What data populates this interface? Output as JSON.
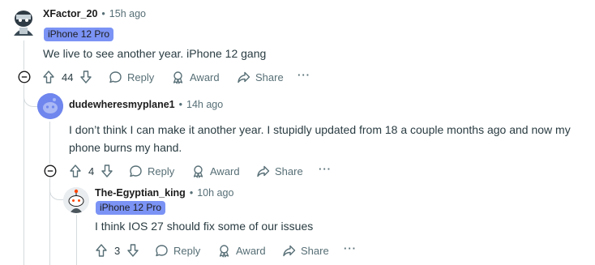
{
  "comments": [
    {
      "author": "XFactor_20",
      "time": "15h ago",
      "flair": "iPhone 12 Pro",
      "body": "We live to see another year. iPhone 12 gang",
      "votes": "44",
      "actions": {
        "reply": "Reply",
        "award": "Award",
        "share": "Share",
        "more": "···"
      }
    },
    {
      "author": "dudewheresmyplane1",
      "time": "14h ago",
      "body_line1": "I don’t think I can make it another year. I stupidly updated from 18 a couple months ago and now my",
      "body_line2": "phone burns my hand.",
      "votes": "4",
      "actions": {
        "reply": "Reply",
        "award": "Award",
        "share": "Share",
        "more": "···"
      }
    },
    {
      "author": "The-Egyptian_king",
      "time": "10h ago",
      "flair": "iPhone 12 Pro",
      "body": "I think IOS 27 should fix some of our issues",
      "votes": "3",
      "actions": {
        "reply": "Reply",
        "award": "Award",
        "share": "Share",
        "more": "···"
      }
    }
  ],
  "separator": "•",
  "colors": {
    "flair_bg": "#7b93f5",
    "meta": "#576f76",
    "thread_line": "#d4dadd",
    "avatar_blue": "#6f86ee"
  }
}
